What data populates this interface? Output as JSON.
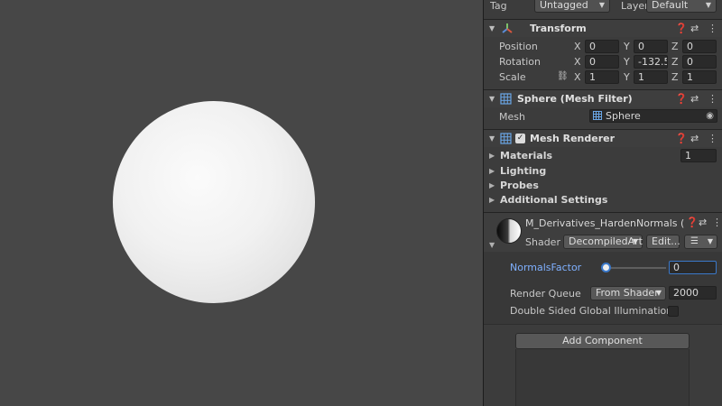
{
  "top": {
    "tag_label": "Tag",
    "tag_value": "Untagged",
    "layer_label": "Layer",
    "layer_value": "Default"
  },
  "transform": {
    "title": "Transform",
    "position_label": "Position",
    "rotation_label": "Rotation",
    "scale_label": "Scale",
    "axis_x": "X",
    "axis_y": "Y",
    "axis_z": "Z",
    "position": {
      "x": "0",
      "y": "0",
      "z": "0"
    },
    "rotation": {
      "x": "0",
      "y": "-132.52",
      "z": "0"
    },
    "scale": {
      "x": "1",
      "y": "1",
      "z": "1"
    }
  },
  "mesh_filter": {
    "title": "Sphere (Mesh Filter)",
    "mesh_label": "Mesh",
    "mesh_value": "Sphere"
  },
  "mesh_renderer": {
    "title": "Mesh Renderer",
    "enabled": true,
    "materials_label": "Materials",
    "materials_count": "1",
    "lighting_label": "Lighting",
    "probes_label": "Probes",
    "additional_label": "Additional Settings"
  },
  "material": {
    "name": "M_Derivatives_HardenNormals (I",
    "shader_label": "Shader",
    "shader_value": "DecompiledArt",
    "edit_label": "Edit...",
    "normals_label": "NormalsFactor",
    "normals_value": "0",
    "normals_slider_fraction": 0,
    "render_queue_label": "Render Queue",
    "render_queue_source": "From Shader",
    "render_queue_value": "2000",
    "double_sided_label": "Double Sided Global Illumination",
    "double_sided_checked": false
  },
  "add_component_label": "Add Component",
  "colors": {
    "accent_blue": "#3a78c9",
    "link_label": "#7fb0ff"
  },
  "icons": [
    "transform-axes-icon",
    "mesh-grid-icon",
    "help-icon",
    "preset-icon",
    "kebab-menu-icon",
    "link-scale-icon",
    "object-picker-icon",
    "checkmark-icon",
    "list-icon"
  ]
}
